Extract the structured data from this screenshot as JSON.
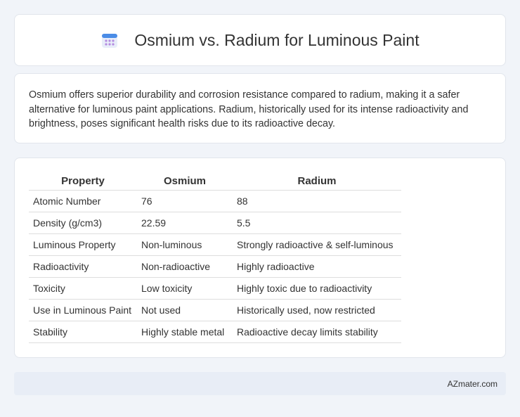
{
  "header": {
    "title": "Osmium vs. Radium for Luminous Paint",
    "icon": "calendar-icon",
    "icon_colors": {
      "top": "#4a8ce6",
      "body": "#e8edf9",
      "dots": "#b48be0"
    }
  },
  "intro": {
    "text": "Osmium offers superior durability and corrosion resistance compared to radium, making it a safer alternative for luminous paint applications. Radium, historically used for its intense radioactivity and brightness, poses significant health risks due to its radioactive decay."
  },
  "table": {
    "headers": [
      "Property",
      "Osmium",
      "Radium"
    ],
    "rows": [
      [
        "Atomic Number",
        "76",
        "88"
      ],
      [
        "Density (g/cm3)",
        "22.59",
        "5.5"
      ],
      [
        "Luminous Property",
        "Non-luminous",
        "Strongly radioactive & self-luminous"
      ],
      [
        "Radioactivity",
        "Non-radioactive",
        "Highly radioactive"
      ],
      [
        "Toxicity",
        "Low toxicity",
        "Highly toxic due to radioactivity"
      ],
      [
        "Use in Luminous Paint",
        "Not used",
        "Historically used, now restricted"
      ],
      [
        "Stability",
        "Highly stable metal",
        "Radioactive decay limits stability"
      ]
    ]
  },
  "footer": {
    "text": "AZmater.com"
  }
}
